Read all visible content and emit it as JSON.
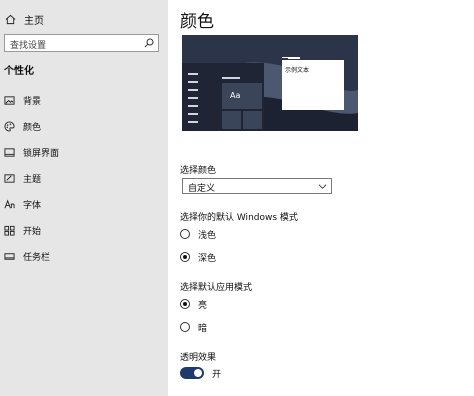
{
  "sidebar": {
    "home_label": "主页",
    "search_placeholder": "查找设置",
    "section_title": "个性化",
    "items": [
      {
        "label": "背景",
        "icon": "picture-icon"
      },
      {
        "label": "颜色",
        "icon": "palette-icon"
      },
      {
        "label": "锁屏界面",
        "icon": "lock-screen-icon"
      },
      {
        "label": "主题",
        "icon": "brush-icon"
      },
      {
        "label": "字体",
        "icon": "font-icon"
      },
      {
        "label": "开始",
        "icon": "start-icon"
      },
      {
        "label": "任务栏",
        "icon": "taskbar-icon"
      }
    ]
  },
  "main": {
    "title": "颜色",
    "preview": {
      "tile_label": "Aa",
      "window_text": "示例文本"
    },
    "choose_color": {
      "label": "选择颜色",
      "value": "自定义"
    },
    "windows_mode": {
      "label": "选择你的默认 Windows 模式",
      "options": [
        {
          "label": "浅色",
          "selected": false
        },
        {
          "label": "深色",
          "selected": true
        }
      ]
    },
    "app_mode": {
      "label": "选择默认应用模式",
      "options": [
        {
          "label": "亮",
          "selected": true
        },
        {
          "label": "暗",
          "selected": false
        }
      ]
    },
    "transparency": {
      "label": "透明效果",
      "state_label": "开",
      "on": true
    }
  },
  "colors": {
    "sidebar_bg": "#e6e6e6",
    "toggle_on": "#1f3a6a",
    "preview_bg": "#2d3850"
  }
}
